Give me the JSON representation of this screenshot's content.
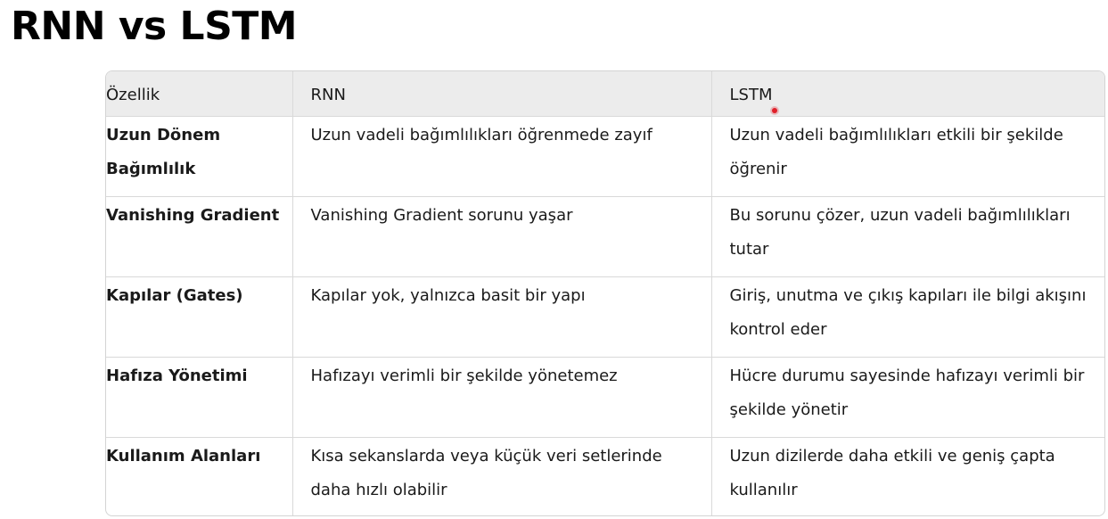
{
  "title": "RNN vs LSTM",
  "table": {
    "headers": [
      "Özellik",
      "RNN",
      "LSTM"
    ],
    "rows": [
      [
        "Uzun Dönem Bağımlılık",
        "Uzun vadeli bağımlılıkları öğrenmede zayıf",
        "Uzun vadeli bağımlılıkları etkili bir şekilde öğrenir"
      ],
      [
        "Vanishing Gradient",
        "Vanishing Gradient sorunu yaşar",
        "Bu sorunu çözer, uzun vadeli bağımlılıkları tutar"
      ],
      [
        "Kapılar (Gates)",
        "Kapılar yok, yalnızca basit bir yapı",
        "Giriş, unutma ve çıkış kapıları ile bilgi akışını kontrol eder"
      ],
      [
        "Hafıza Yönetimi",
        "Hafızayı verimli bir şekilde yönetemez",
        "Hücre durumu sayesinde hafızayı verimli bir şekilde yönetir"
      ],
      [
        "Kullanım Alanları",
        "Kısa sekanslarda veya küçük veri setlerinde daha hızlı olabilir",
        "Uzun dizilerde daha etkili ve geniş çapta kullanılır"
      ]
    ]
  },
  "colors": {
    "header_bg": "#ececec",
    "border": "#d9d9d9",
    "cursor": "#e0202a"
  }
}
